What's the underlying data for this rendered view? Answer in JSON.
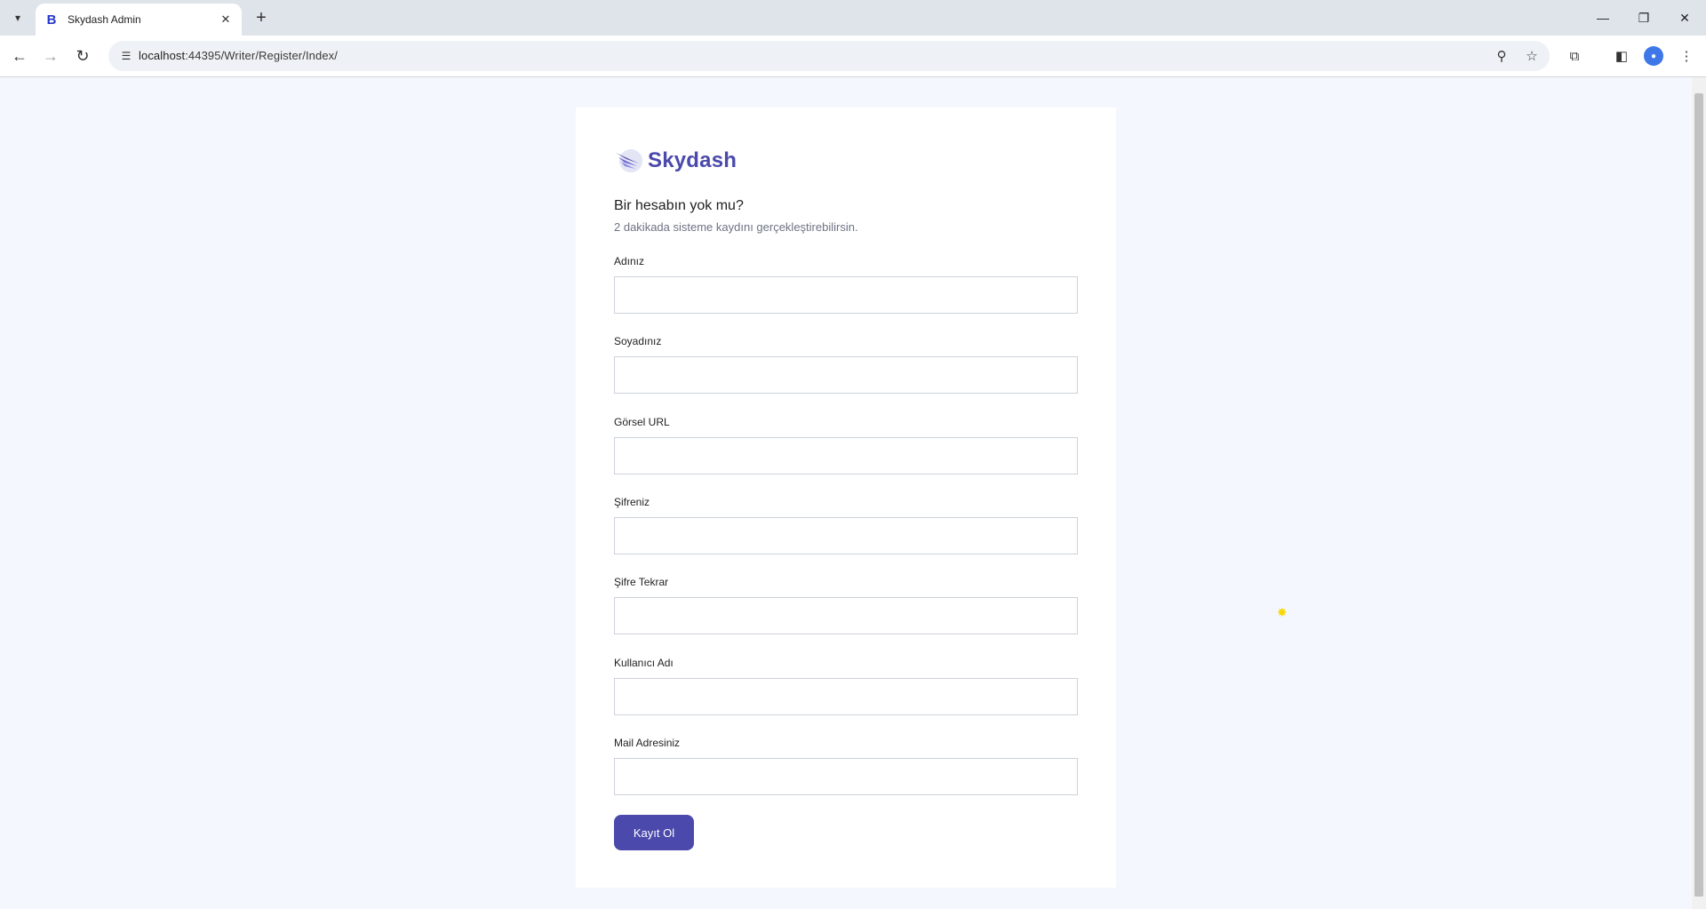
{
  "browser": {
    "tab_title": "Skydash Admin",
    "tab_favicon_letter": "B",
    "url_host": "localhost",
    "url_rest": ":44395/Writer/Register/Index/"
  },
  "brand": {
    "name": "Skydash"
  },
  "form": {
    "heading": "Bir hesabın yok mu?",
    "subheading": "2 dakikada sisteme kaydını gerçekleştirebilirsin.",
    "fields": [
      {
        "label": "Adınız",
        "value": ""
      },
      {
        "label": "Soyadınız",
        "value": ""
      },
      {
        "label": "Görsel URL",
        "value": ""
      },
      {
        "label": "Şifreniz",
        "value": ""
      },
      {
        "label": "Şifre Tekrar",
        "value": ""
      },
      {
        "label": "Kullanıcı Adı",
        "value": ""
      },
      {
        "label": "Mail Adresiniz",
        "value": ""
      }
    ],
    "submit_label": "Kayıt Ol"
  },
  "colors": {
    "accent": "#4b49ac",
    "page_bg": "#f4f7fd"
  }
}
